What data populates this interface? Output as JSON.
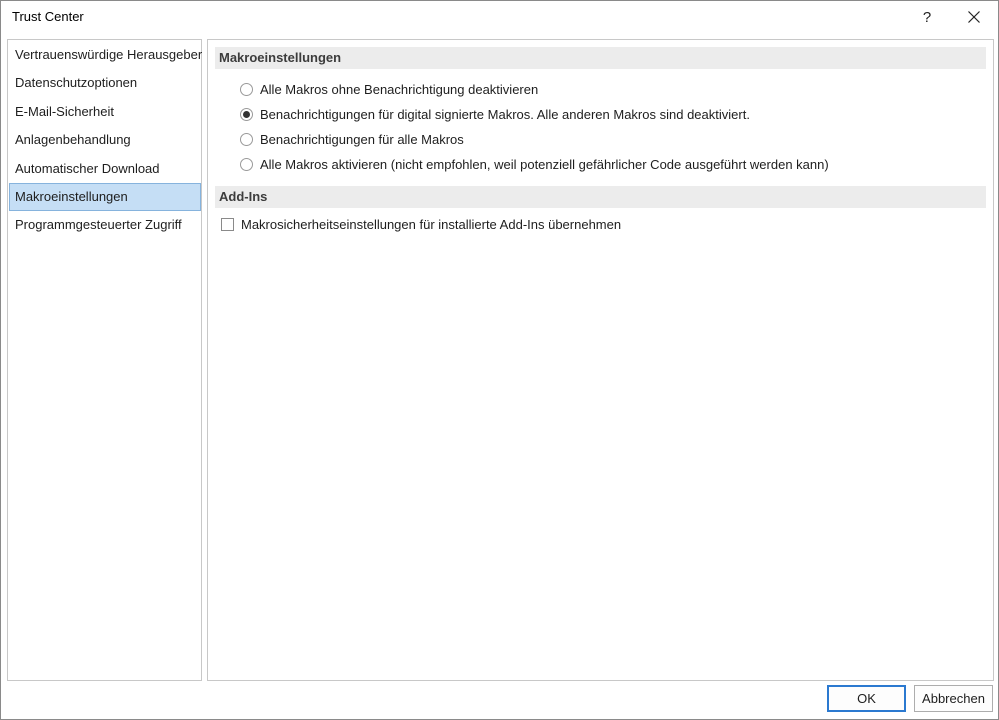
{
  "window": {
    "title": "Trust Center",
    "help_label": "?"
  },
  "sidebar": {
    "items": [
      {
        "label": "Vertrauenswürdige Herausgeber",
        "selected": false
      },
      {
        "label": "Datenschutzoptionen",
        "selected": false
      },
      {
        "label": "E-Mail-Sicherheit",
        "selected": false
      },
      {
        "label": "Anlagenbehandlung",
        "selected": false
      },
      {
        "label": "Automatischer Download",
        "selected": false
      },
      {
        "label": "Makroeinstellungen",
        "selected": true
      },
      {
        "label": "Programmgesteuerter Zugriff",
        "selected": false
      }
    ]
  },
  "macro_settings": {
    "header": "Makroeinstellungen",
    "options": [
      {
        "label": "Alle Makros ohne Benachrichtigung deaktivieren",
        "checked": false
      },
      {
        "label": "Benachrichtigungen für digital signierte Makros. Alle anderen Makros sind deaktiviert.",
        "checked": true
      },
      {
        "label": "Benachrichtigungen für alle Makros",
        "checked": false
      },
      {
        "label": "Alle Makros aktivieren (nicht empfohlen, weil potenziell gefährlicher Code ausgeführt werden kann)",
        "checked": false
      }
    ]
  },
  "addins": {
    "header": "Add-Ins",
    "checkbox_label": "Makrosicherheitseinstellungen für installierte Add-Ins übernehmen",
    "checked": false
  },
  "buttons": {
    "ok_label": "OK",
    "cancel_label": "Abbrechen"
  },
  "colors": {
    "selection_bg": "#c5def5",
    "default_button_border": "#2b79d0"
  }
}
